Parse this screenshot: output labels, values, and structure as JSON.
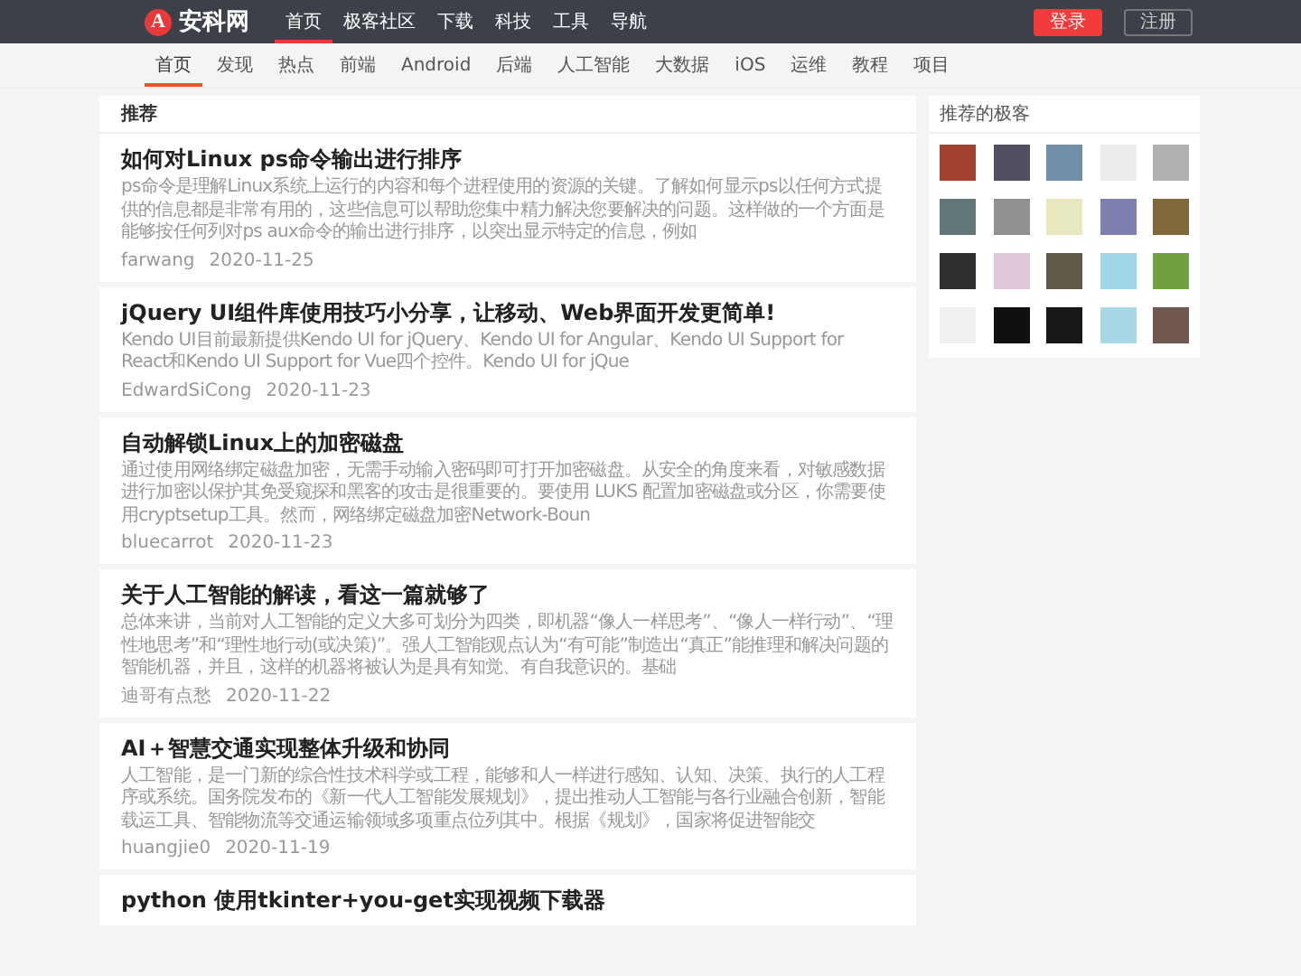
{
  "header": {
    "logo": {
      "mark": "A",
      "name": "安科网"
    },
    "nav": [
      {
        "label": "首页",
        "selected": true
      },
      {
        "label": "极客社区",
        "selected": false
      },
      {
        "label": "下载",
        "selected": false
      },
      {
        "label": "科技",
        "selected": false
      },
      {
        "label": "工具",
        "selected": false
      },
      {
        "label": "导航",
        "selected": false
      }
    ],
    "login": "登录",
    "register": "注册"
  },
  "subnav": [
    {
      "label": "首页",
      "selected": true
    },
    {
      "label": "发现",
      "selected": false
    },
    {
      "label": "热点",
      "selected": false
    },
    {
      "label": "前端",
      "selected": false
    },
    {
      "label": "Android",
      "selected": false
    },
    {
      "label": "后端",
      "selected": false
    },
    {
      "label": "人工智能",
      "selected": false
    },
    {
      "label": "大数据",
      "selected": false
    },
    {
      "label": "iOS",
      "selected": false
    },
    {
      "label": "运维",
      "selected": false
    },
    {
      "label": "教程",
      "selected": false
    },
    {
      "label": "项目",
      "selected": false
    }
  ],
  "feed": {
    "title": "推荐",
    "articles": [
      {
        "title": "如何对Linux ps命令输出进行排序",
        "excerpt": "ps命令是理解Linux系统上运行的内容和每个进程使用的资源的关键。了解如何显示ps以任何方式提供的信息都是非常有用的，这些信息可以帮助您集中精力解决您要解决的问题。这样做的一个方面是能够按任何列对ps aux命令的输出进行排序，以突出显示特定的信息，例如",
        "author": "farwang",
        "date": "2020-11-25"
      },
      {
        "title": "jQuery UI组件库使用技巧小分享，让移动、Web界面开发更简单!",
        "excerpt": "Kendo UI目前最新提供Kendo UI for jQuery、Kendo UI for Angular、Kendo UI Support for React和Kendo UI Support for Vue四个控件。Kendo UI for jQue",
        "author": "EdwardSiCong",
        "date": "2020-11-23"
      },
      {
        "title": "自动解锁Linux上的加密磁盘",
        "excerpt": "通过使用网络绑定磁盘加密，无需手动输入密码即可打开加密磁盘。从安全的角度来看，对敏感数据进行加密以保护其免受窥探和黑客的攻击是很重要的。要使用 LUKS 配置加密磁盘或分区，你需要使用cryptsetup工具。然而，网络绑定磁盘加密Network-Boun",
        "author": "bluecarrot",
        "date": "2020-11-23"
      },
      {
        "title": "关于人工智能的解读，看这一篇就够了",
        "excerpt": "总体来讲，当前对人工智能的定义大多可划分为四类，即机器“像人一样思考”、“像人一样行动”、“理性地思考”和“理性地行动(或决策)”。强人工智能观点认为“有可能”制造出“真正”能推理和解决问题的智能机器，并且，这样的机器将被认为是具有知觉、有自我意识的。基础",
        "author": "迪哥有点愁",
        "date": "2020-11-22"
      },
      {
        "title": "AI＋智慧交通实现整体升级和协同",
        "excerpt": "人工智能，是一门新的综合性技术科学或工程，能够和人一样进行感知、认知、决策、执行的人工程序或系统。国务院发布的《新一代人工智能发展规划》，提出推动人工智能与各行业融合创新，智能载运工具、智能物流等交通运输领域多项重点位列其中。根据《规划》，国家将促进智能交",
        "author": "huangjie0",
        "date": "2020-11-19"
      },
      {
        "title": "python 使用tkinter+you-get实现视频下载器"
      }
    ]
  },
  "sidebar": {
    "title": "推荐的极客",
    "avatars": [
      {
        "color": "#a04030"
      },
      {
        "color": "#505060"
      },
      {
        "color": "#7090a8"
      },
      {
        "color": "#ececec"
      },
      {
        "color": "#b0b0b0"
      },
      {
        "color": "#607878"
      },
      {
        "color": "#909090"
      },
      {
        "color": "#e8e8c0"
      },
      {
        "color": "#8080b0"
      },
      {
        "color": "#806838"
      },
      {
        "color": "#303030"
      },
      {
        "color": "#e0c8d8"
      },
      {
        "color": "#605848"
      },
      {
        "color": "#a0d8e8"
      },
      {
        "color": "#70a040"
      },
      {
        "color": "#f0f0f0"
      },
      {
        "color": "#101010"
      },
      {
        "color": "#181818"
      },
      {
        "color": "#a8d8e8"
      },
      {
        "color": "#705850"
      }
    ]
  }
}
